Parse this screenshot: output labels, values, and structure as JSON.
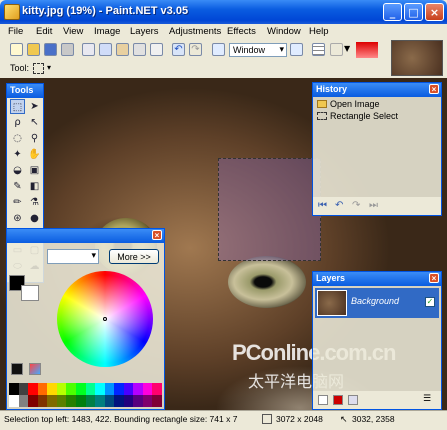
{
  "window": {
    "title": "kitty.jpg (19%) - Paint.NET v3.05",
    "min": "_",
    "max": "□",
    "close": "×"
  },
  "menu": [
    "File",
    "Edit",
    "View",
    "Image",
    "Layers",
    "Adjustments",
    "Effects",
    "Window",
    "Help"
  ],
  "toolbar": {
    "zoom_mode": "Window",
    "tool_label": "Tool:"
  },
  "tools_panel": {
    "title": "Tools"
  },
  "history_panel": {
    "title": "History",
    "items": [
      "Open Image",
      "Rectangle Select"
    ]
  },
  "colors_panel": {
    "more_button": "More >>"
  },
  "layers_panel": {
    "title": "Layers",
    "layer_name": "Background"
  },
  "watermark": {
    "line1": "PConline.com.cn",
    "line2": "太平洋电脑网"
  },
  "status": {
    "selection": "Selection top left: 1483, 422. Bounding rectangle size: 741 x 7",
    "image_size": "3072 x 2048",
    "cursor": "3032, 2358"
  },
  "colors": {
    "title_active": "#0a5ce0",
    "selection_tint": "#8c6ec8",
    "layer_highlight": "#316ac5"
  },
  "icons": [
    "new-icon",
    "open-icon",
    "save-icon",
    "print-icon",
    "cut-icon",
    "copy-icon",
    "paste-icon",
    "crop-icon",
    "deselect-icon",
    "undo-icon",
    "redo-icon",
    "zoom-out-icon",
    "zoom-in-icon",
    "grid-icon"
  ]
}
